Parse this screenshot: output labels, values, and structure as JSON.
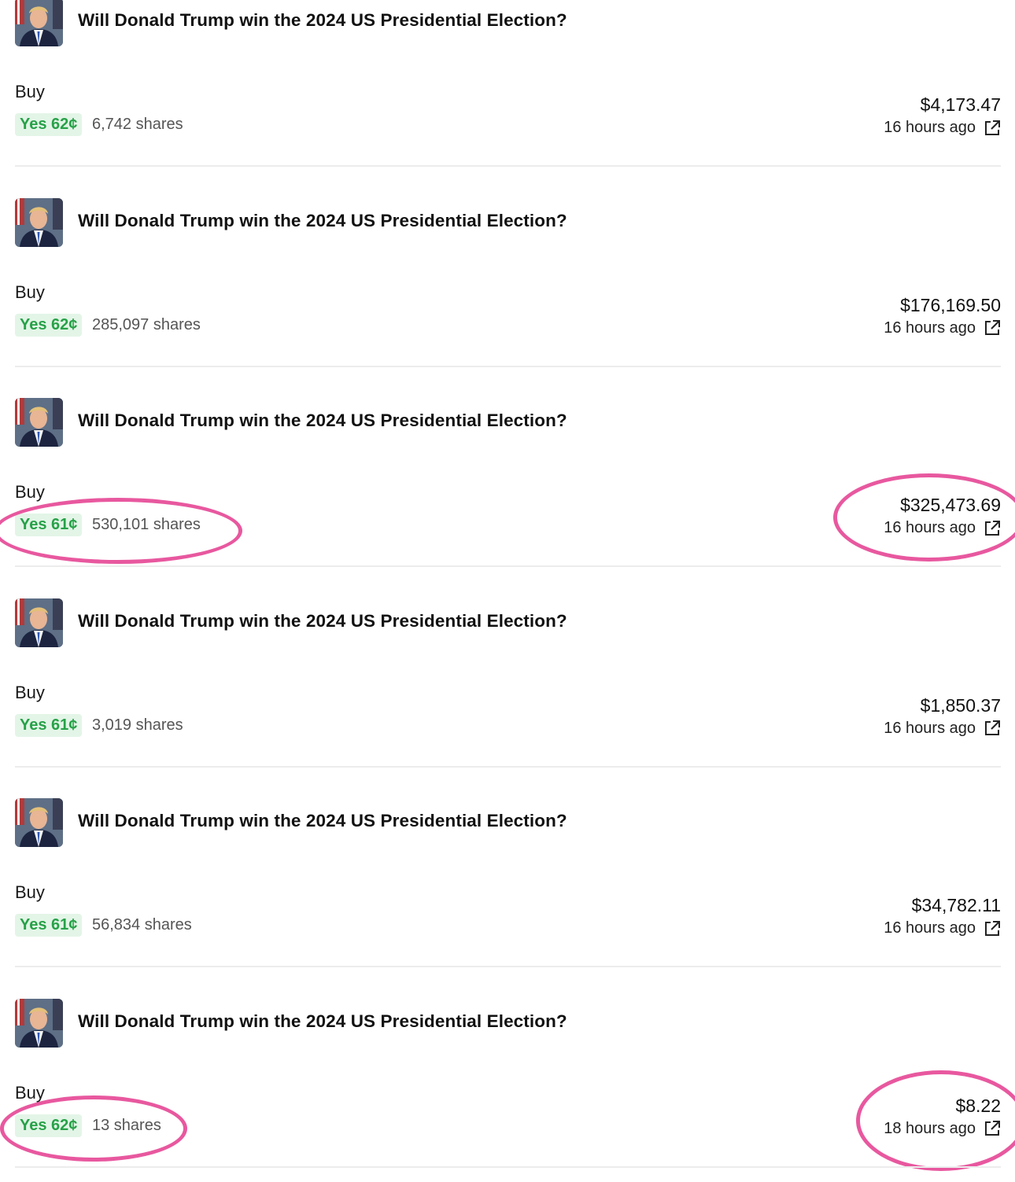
{
  "icons": {
    "avatar": "market-avatar-portrait-icon",
    "external_link": "external-link-icon"
  },
  "colors": {
    "yes_text": "#27a148",
    "yes_background": "#e3f5e7",
    "highlight": "#e8589f",
    "divider": "#ececec"
  },
  "trades": [
    {
      "market_title": "Will Donald Trump win the 2024 US Presidential Election?",
      "side": "Buy",
      "outcome": "Yes 62¢",
      "shares": "6,742 shares",
      "amount": "$4,173.47",
      "time": "16 hours ago",
      "highlighted": false
    },
    {
      "market_title": "Will Donald Trump win the 2024 US Presidential Election?",
      "side": "Buy",
      "outcome": "Yes 62¢",
      "shares": "285,097 shares",
      "amount": "$176,169.50",
      "time": "16 hours ago",
      "highlighted": false
    },
    {
      "market_title": "Will Donald Trump win the 2024 US Presidential Election?",
      "side": "Buy",
      "outcome": "Yes 61¢",
      "shares": "530,101 shares",
      "amount": "$325,473.69",
      "time": "16 hours ago",
      "highlighted": true
    },
    {
      "market_title": "Will Donald Trump win the 2024 US Presidential Election?",
      "side": "Buy",
      "outcome": "Yes 61¢",
      "shares": "3,019 shares",
      "amount": "$1,850.37",
      "time": "16 hours ago",
      "highlighted": false
    },
    {
      "market_title": "Will Donald Trump win the 2024 US Presidential Election?",
      "side": "Buy",
      "outcome": "Yes 61¢",
      "shares": "56,834 shares",
      "amount": "$34,782.11",
      "time": "16 hours ago",
      "highlighted": false
    },
    {
      "market_title": "Will Donald Trump win the 2024 US Presidential Election?",
      "side": "Buy",
      "outcome": "Yes 62¢",
      "shares": "13 shares",
      "amount": "$8.22",
      "time": "18 hours ago",
      "highlighted": true
    }
  ]
}
